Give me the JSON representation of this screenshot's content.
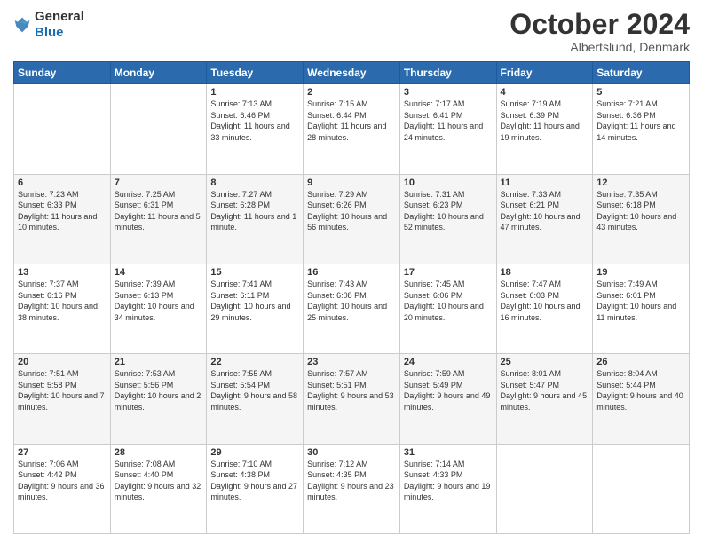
{
  "header": {
    "logo_general": "General",
    "logo_blue": "Blue",
    "month_title": "October 2024",
    "location": "Albertslund, Denmark"
  },
  "weekdays": [
    "Sunday",
    "Monday",
    "Tuesday",
    "Wednesday",
    "Thursday",
    "Friday",
    "Saturday"
  ],
  "rows": [
    [
      {
        "day": "",
        "sunrise": "",
        "sunset": "",
        "daylight": ""
      },
      {
        "day": "",
        "sunrise": "",
        "sunset": "",
        "daylight": ""
      },
      {
        "day": "1",
        "sunrise": "Sunrise: 7:13 AM",
        "sunset": "Sunset: 6:46 PM",
        "daylight": "Daylight: 11 hours and 33 minutes."
      },
      {
        "day": "2",
        "sunrise": "Sunrise: 7:15 AM",
        "sunset": "Sunset: 6:44 PM",
        "daylight": "Daylight: 11 hours and 28 minutes."
      },
      {
        "day": "3",
        "sunrise": "Sunrise: 7:17 AM",
        "sunset": "Sunset: 6:41 PM",
        "daylight": "Daylight: 11 hours and 24 minutes."
      },
      {
        "day": "4",
        "sunrise": "Sunrise: 7:19 AM",
        "sunset": "Sunset: 6:39 PM",
        "daylight": "Daylight: 11 hours and 19 minutes."
      },
      {
        "day": "5",
        "sunrise": "Sunrise: 7:21 AM",
        "sunset": "Sunset: 6:36 PM",
        "daylight": "Daylight: 11 hours and 14 minutes."
      }
    ],
    [
      {
        "day": "6",
        "sunrise": "Sunrise: 7:23 AM",
        "sunset": "Sunset: 6:33 PM",
        "daylight": "Daylight: 11 hours and 10 minutes."
      },
      {
        "day": "7",
        "sunrise": "Sunrise: 7:25 AM",
        "sunset": "Sunset: 6:31 PM",
        "daylight": "Daylight: 11 hours and 5 minutes."
      },
      {
        "day": "8",
        "sunrise": "Sunrise: 7:27 AM",
        "sunset": "Sunset: 6:28 PM",
        "daylight": "Daylight: 11 hours and 1 minute."
      },
      {
        "day": "9",
        "sunrise": "Sunrise: 7:29 AM",
        "sunset": "Sunset: 6:26 PM",
        "daylight": "Daylight: 10 hours and 56 minutes."
      },
      {
        "day": "10",
        "sunrise": "Sunrise: 7:31 AM",
        "sunset": "Sunset: 6:23 PM",
        "daylight": "Daylight: 10 hours and 52 minutes."
      },
      {
        "day": "11",
        "sunrise": "Sunrise: 7:33 AM",
        "sunset": "Sunset: 6:21 PM",
        "daylight": "Daylight: 10 hours and 47 minutes."
      },
      {
        "day": "12",
        "sunrise": "Sunrise: 7:35 AM",
        "sunset": "Sunset: 6:18 PM",
        "daylight": "Daylight: 10 hours and 43 minutes."
      }
    ],
    [
      {
        "day": "13",
        "sunrise": "Sunrise: 7:37 AM",
        "sunset": "Sunset: 6:16 PM",
        "daylight": "Daylight: 10 hours and 38 minutes."
      },
      {
        "day": "14",
        "sunrise": "Sunrise: 7:39 AM",
        "sunset": "Sunset: 6:13 PM",
        "daylight": "Daylight: 10 hours and 34 minutes."
      },
      {
        "day": "15",
        "sunrise": "Sunrise: 7:41 AM",
        "sunset": "Sunset: 6:11 PM",
        "daylight": "Daylight: 10 hours and 29 minutes."
      },
      {
        "day": "16",
        "sunrise": "Sunrise: 7:43 AM",
        "sunset": "Sunset: 6:08 PM",
        "daylight": "Daylight: 10 hours and 25 minutes."
      },
      {
        "day": "17",
        "sunrise": "Sunrise: 7:45 AM",
        "sunset": "Sunset: 6:06 PM",
        "daylight": "Daylight: 10 hours and 20 minutes."
      },
      {
        "day": "18",
        "sunrise": "Sunrise: 7:47 AM",
        "sunset": "Sunset: 6:03 PM",
        "daylight": "Daylight: 10 hours and 16 minutes."
      },
      {
        "day": "19",
        "sunrise": "Sunrise: 7:49 AM",
        "sunset": "Sunset: 6:01 PM",
        "daylight": "Daylight: 10 hours and 11 minutes."
      }
    ],
    [
      {
        "day": "20",
        "sunrise": "Sunrise: 7:51 AM",
        "sunset": "Sunset: 5:58 PM",
        "daylight": "Daylight: 10 hours and 7 minutes."
      },
      {
        "day": "21",
        "sunrise": "Sunrise: 7:53 AM",
        "sunset": "Sunset: 5:56 PM",
        "daylight": "Daylight: 10 hours and 2 minutes."
      },
      {
        "day": "22",
        "sunrise": "Sunrise: 7:55 AM",
        "sunset": "Sunset: 5:54 PM",
        "daylight": "Daylight: 9 hours and 58 minutes."
      },
      {
        "day": "23",
        "sunrise": "Sunrise: 7:57 AM",
        "sunset": "Sunset: 5:51 PM",
        "daylight": "Daylight: 9 hours and 53 minutes."
      },
      {
        "day": "24",
        "sunrise": "Sunrise: 7:59 AM",
        "sunset": "Sunset: 5:49 PM",
        "daylight": "Daylight: 9 hours and 49 minutes."
      },
      {
        "day": "25",
        "sunrise": "Sunrise: 8:01 AM",
        "sunset": "Sunset: 5:47 PM",
        "daylight": "Daylight: 9 hours and 45 minutes."
      },
      {
        "day": "26",
        "sunrise": "Sunrise: 8:04 AM",
        "sunset": "Sunset: 5:44 PM",
        "daylight": "Daylight: 9 hours and 40 minutes."
      }
    ],
    [
      {
        "day": "27",
        "sunrise": "Sunrise: 7:06 AM",
        "sunset": "Sunset: 4:42 PM",
        "daylight": "Daylight: 9 hours and 36 minutes."
      },
      {
        "day": "28",
        "sunrise": "Sunrise: 7:08 AM",
        "sunset": "Sunset: 4:40 PM",
        "daylight": "Daylight: 9 hours and 32 minutes."
      },
      {
        "day": "29",
        "sunrise": "Sunrise: 7:10 AM",
        "sunset": "Sunset: 4:38 PM",
        "daylight": "Daylight: 9 hours and 27 minutes."
      },
      {
        "day": "30",
        "sunrise": "Sunrise: 7:12 AM",
        "sunset": "Sunset: 4:35 PM",
        "daylight": "Daylight: 9 hours and 23 minutes."
      },
      {
        "day": "31",
        "sunrise": "Sunrise: 7:14 AM",
        "sunset": "Sunset: 4:33 PM",
        "daylight": "Daylight: 9 hours and 19 minutes."
      },
      {
        "day": "",
        "sunrise": "",
        "sunset": "",
        "daylight": ""
      },
      {
        "day": "",
        "sunrise": "",
        "sunset": "",
        "daylight": ""
      }
    ]
  ]
}
